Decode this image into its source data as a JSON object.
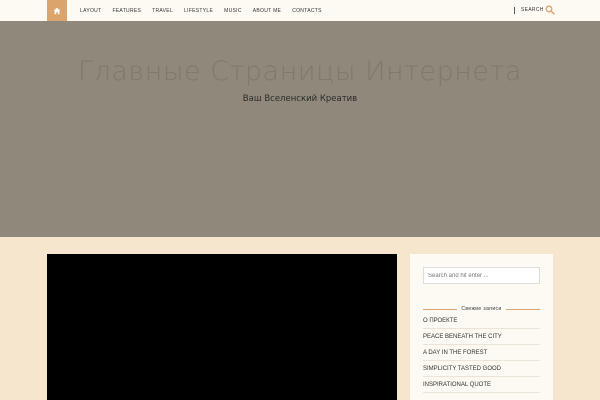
{
  "topbar": {
    "home_icon": "home-icon",
    "nav": [
      {
        "label": "LAYOUT"
      },
      {
        "label": "FEATURES"
      },
      {
        "label": "TRAVEL"
      },
      {
        "label": "LIFESTYLE"
      },
      {
        "label": "MUSIC"
      },
      {
        "label": "ABOUT ME"
      },
      {
        "label": "CONTACTS"
      }
    ],
    "search_label": "SEARCH",
    "search_icon": "search-icon"
  },
  "hero": {
    "title": "Главные Страницы Интернета",
    "tagline": "Ваш Вселенский Креатив"
  },
  "sidebar": {
    "search_placeholder": "Search and hit enter ...",
    "recent_title": "Свежие записи",
    "recent_posts": [
      {
        "label": "О ПРОЕКТЕ"
      },
      {
        "label": "PEACE BENEATH THE CITY"
      },
      {
        "label": "A DAY IN THE FOREST"
      },
      {
        "label": "SIMPLICITY TASTED GOOD"
      },
      {
        "label": "INSPIRATIONAL QUOTE"
      }
    ]
  },
  "colors": {
    "accent": "#dba46c",
    "page_bg": "#f5e6cd",
    "hero_bg": "#8f887b",
    "topbar_bg": "#fdf9f3"
  }
}
